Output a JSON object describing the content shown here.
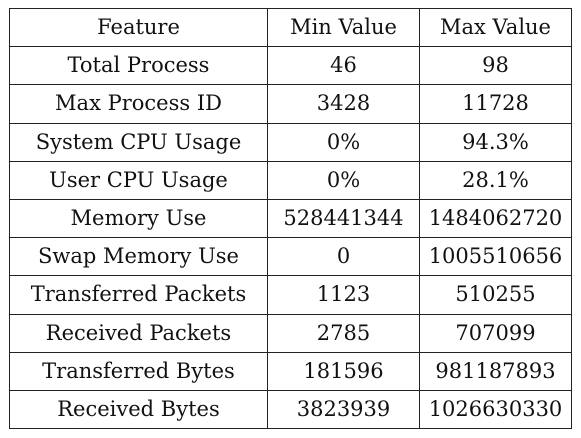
{
  "table": {
    "headers": [
      "Feature",
      "Min Value",
      "Max Value"
    ],
    "rows": [
      [
        "Total Process",
        "46",
        "98"
      ],
      [
        "Max Process ID",
        "3428",
        "11728"
      ],
      [
        "System CPU Usage",
        "0%",
        "94.3%"
      ],
      [
        "User CPU Usage",
        "0%",
        "28.1%"
      ],
      [
        "Memory Use",
        "528441344",
        "1484062720"
      ],
      [
        "Swap Memory Use",
        "0",
        "1005510656"
      ],
      [
        "Transferred Packets",
        "1123",
        "510255"
      ],
      [
        "Received Packets",
        "2785",
        "707099"
      ],
      [
        "Transferred Bytes",
        "181596",
        "981187893"
      ],
      [
        "Received Bytes",
        "3823939",
        "1026630330"
      ]
    ]
  }
}
